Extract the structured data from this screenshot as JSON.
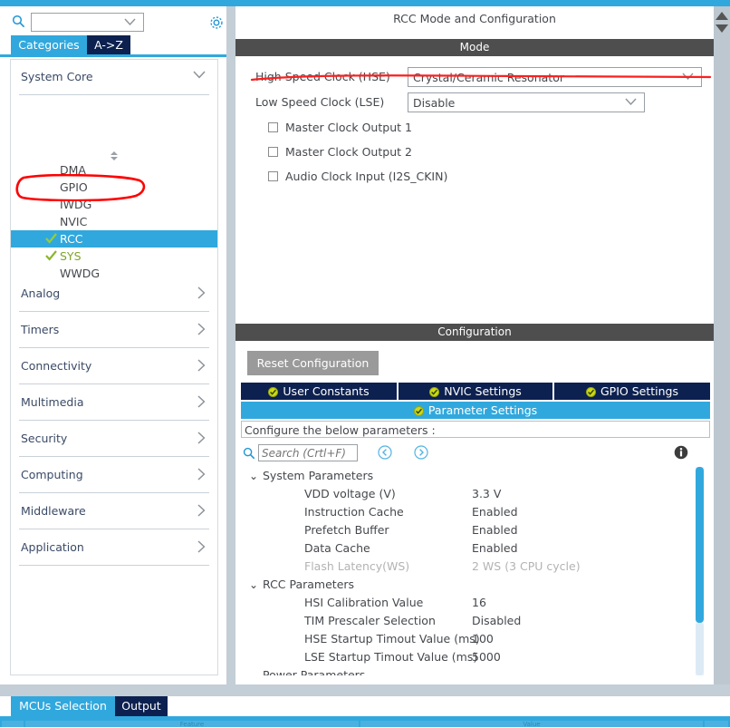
{
  "left_panel": {
    "search": {
      "value": "",
      "placeholder": "",
      "icon": "search-icon"
    },
    "gear_icon": "gear-icon",
    "tabs": [
      {
        "label": "Categories",
        "selected": true
      },
      {
        "label": "A->Z",
        "selected": false
      }
    ],
    "group": {
      "label": "System Core",
      "expanded": true,
      "arrow": "chevron-down-icon"
    },
    "modules": [
      {
        "label": "DMA",
        "selected": false,
        "configured": false
      },
      {
        "label": "GPIO",
        "selected": false,
        "configured": false
      },
      {
        "label": "IWDG",
        "selected": false,
        "configured": false
      },
      {
        "label": "NVIC",
        "selected": false,
        "configured": false
      },
      {
        "label": "RCC",
        "selected": true,
        "configured": true
      },
      {
        "label": "SYS",
        "selected": false,
        "configured": true
      },
      {
        "label": "WWDG",
        "selected": false,
        "configured": false
      }
    ],
    "categories": [
      {
        "label": "Analog",
        "arrow": "chevron-right-icon"
      },
      {
        "label": "Timers",
        "arrow": "chevron-right-icon"
      },
      {
        "label": "Connectivity",
        "arrow": "chevron-right-icon"
      },
      {
        "label": "Multimedia",
        "arrow": "chevron-right-icon"
      },
      {
        "label": "Security",
        "arrow": "chevron-right-icon"
      },
      {
        "label": "Computing",
        "arrow": "chevron-right-icon"
      },
      {
        "label": "Middleware",
        "arrow": "chevron-right-icon"
      },
      {
        "label": "Application",
        "arrow": "chevron-right-icon"
      }
    ]
  },
  "right_panel": {
    "title": "RCC Mode and Configuration",
    "mode": {
      "band_label": "Mode",
      "selects": [
        {
          "label": "High Speed Clock (HSE)",
          "value": "Crystal/Ceramic Resonator"
        },
        {
          "label": "Low Speed Clock (LSE)",
          "value": "Disable"
        }
      ],
      "checkboxes": [
        {
          "label": "Master Clock Output 1",
          "checked": false
        },
        {
          "label": "Master Clock Output 2",
          "checked": false
        },
        {
          "label": "Audio Clock Input (I2S_CKIN)",
          "checked": false
        }
      ]
    },
    "configuration": {
      "band_label": "Configuration",
      "reset_label": "Reset Configuration",
      "tabs": [
        {
          "label": "User Constants",
          "selected": false,
          "status": "ok"
        },
        {
          "label": "NVIC Settings",
          "selected": false,
          "status": "ok"
        },
        {
          "label": "GPIO Settings",
          "selected": false,
          "status": "ok"
        },
        {
          "label": "Parameter Settings",
          "selected": true,
          "status": "ok"
        }
      ],
      "note": "Configure the below parameters :",
      "search": {
        "value": "",
        "placeholder": "Search (Crtl+F)"
      },
      "nav_prev": "chevron-left-circle-icon",
      "nav_next": "chevron-right-circle-icon",
      "info": "info-icon",
      "tree": [
        {
          "group": "System Parameters",
          "expanded": true,
          "rows": [
            {
              "key": "VDD voltage (V)",
              "value": "3.3 V",
              "disabled": false
            },
            {
              "key": "Instruction Cache",
              "value": "Enabled",
              "disabled": false
            },
            {
              "key": "Prefetch Buffer",
              "value": "Enabled",
              "disabled": false
            },
            {
              "key": "Data Cache",
              "value": "Enabled",
              "disabled": false
            },
            {
              "key": "Flash Latency(WS)",
              "value": "2 WS (3 CPU cycle)",
              "disabled": true
            }
          ]
        },
        {
          "group": "RCC Parameters",
          "expanded": true,
          "rows": [
            {
              "key": "HSI Calibration Value",
              "value": "16",
              "disabled": false
            },
            {
              "key": "TIM Prescaler Selection",
              "value": "Disabled",
              "disabled": false
            },
            {
              "key": "HSE Startup Timout Value (ms)",
              "value": "100",
              "disabled": false
            },
            {
              "key": "LSE Startup Timout Value (ms)",
              "value": "5000",
              "disabled": false
            }
          ]
        },
        {
          "group": "Power Parameters",
          "expanded": true,
          "rows": []
        }
      ]
    }
  },
  "bottom": {
    "tabs": [
      {
        "label": "MCUs Selection",
        "selected": true
      },
      {
        "label": "Output",
        "selected": false
      }
    ],
    "table_headers": [
      "",
      "Feature",
      "Value",
      ""
    ]
  },
  "annotations": [
    {
      "name": "red-oval-around-rcc",
      "color": "#ff0000",
      "shape": "oval"
    },
    {
      "name": "red-underline-hse-row",
      "color": "#fa2020",
      "shape": "line"
    }
  ],
  "colors": {
    "accent_blue": "#31a8dd",
    "navy": "#0d2150",
    "band_gray": "#4e4e4e",
    "panel_bg": "#c3ced6",
    "check_green": "#7fa428",
    "annotation_red": "#ff0000"
  }
}
